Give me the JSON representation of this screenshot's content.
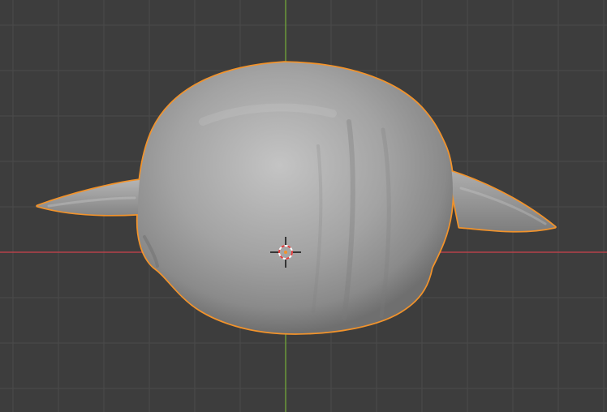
{
  "viewport": {
    "background_color": "#3d3d3d",
    "grid_color": "#4a4a4a",
    "x_axis_color": "#b5424a",
    "y_axis_color": "#6b9a3a"
  },
  "object": {
    "icon": "sculpted-mesh-icon",
    "selection_outline_color": "#f2932b",
    "surface_color": "#9a9a9a",
    "selected": true
  },
  "cursor_3d": {
    "icon": "3d-cursor-icon",
    "ring_colors": [
      "#e03b3b",
      "#ffffff"
    ]
  }
}
